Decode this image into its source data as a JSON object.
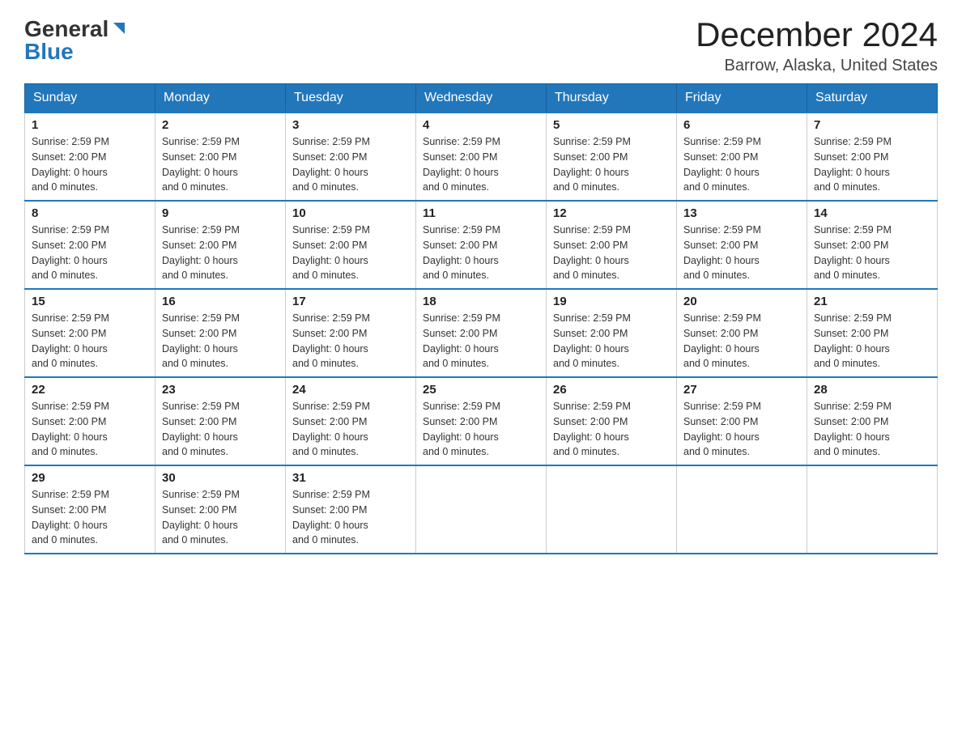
{
  "logo": {
    "general": "General",
    "blue": "Blue"
  },
  "header": {
    "month_title": "December 2024",
    "location": "Barrow, Alaska, United States"
  },
  "days_of_week": [
    "Sunday",
    "Monday",
    "Tuesday",
    "Wednesday",
    "Thursday",
    "Friday",
    "Saturday"
  ],
  "day_info": {
    "sunrise": "Sunrise: 2:59 PM",
    "sunset": "Sunset: 2:00 PM",
    "daylight": "Daylight: 0 hours",
    "daylight2": "and 0 minutes."
  },
  "weeks": [
    [
      {
        "day": "1",
        "has_data": true
      },
      {
        "day": "2",
        "has_data": true
      },
      {
        "day": "3",
        "has_data": true
      },
      {
        "day": "4",
        "has_data": true
      },
      {
        "day": "5",
        "has_data": true
      },
      {
        "day": "6",
        "has_data": true
      },
      {
        "day": "7",
        "has_data": true
      }
    ],
    [
      {
        "day": "8",
        "has_data": true
      },
      {
        "day": "9",
        "has_data": true
      },
      {
        "day": "10",
        "has_data": true
      },
      {
        "day": "11",
        "has_data": true
      },
      {
        "day": "12",
        "has_data": true
      },
      {
        "day": "13",
        "has_data": true
      },
      {
        "day": "14",
        "has_data": true
      }
    ],
    [
      {
        "day": "15",
        "has_data": true
      },
      {
        "day": "16",
        "has_data": true
      },
      {
        "day": "17",
        "has_data": true
      },
      {
        "day": "18",
        "has_data": true
      },
      {
        "day": "19",
        "has_data": true
      },
      {
        "day": "20",
        "has_data": true
      },
      {
        "day": "21",
        "has_data": true
      }
    ],
    [
      {
        "day": "22",
        "has_data": true
      },
      {
        "day": "23",
        "has_data": true
      },
      {
        "day": "24",
        "has_data": true
      },
      {
        "day": "25",
        "has_data": true
      },
      {
        "day": "26",
        "has_data": true
      },
      {
        "day": "27",
        "has_data": true
      },
      {
        "day": "28",
        "has_data": true
      }
    ],
    [
      {
        "day": "29",
        "has_data": true
      },
      {
        "day": "30",
        "has_data": true
      },
      {
        "day": "31",
        "has_data": true
      },
      {
        "day": "",
        "has_data": false
      },
      {
        "day": "",
        "has_data": false
      },
      {
        "day": "",
        "has_data": false
      },
      {
        "day": "",
        "has_data": false
      }
    ]
  ]
}
